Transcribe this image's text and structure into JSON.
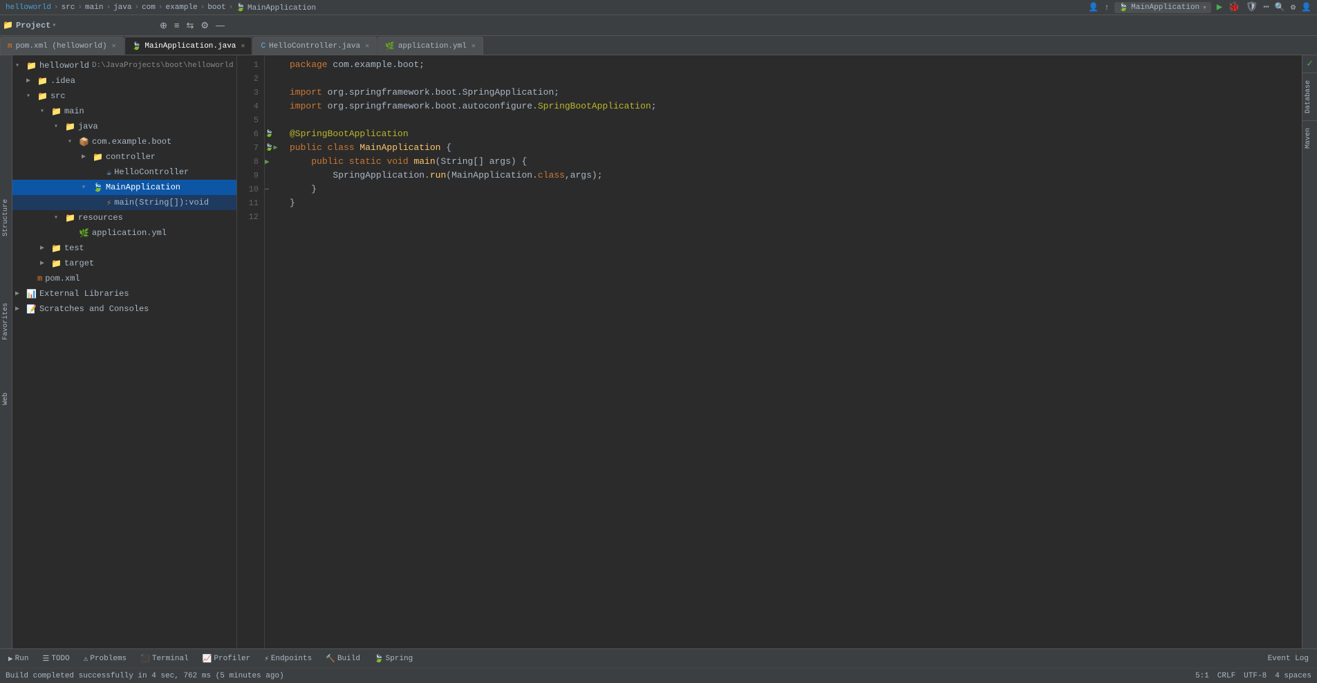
{
  "topbar": {
    "breadcrumb": [
      "helloworld",
      "src",
      "main",
      "java",
      "com",
      "example",
      "boot",
      "MainApplication"
    ],
    "app_name": "MainApplication",
    "run_icon": "▶",
    "search_icon": "🔍"
  },
  "toolbar": {
    "project_label": "Project",
    "icons": [
      "⊕",
      "≡",
      "⇆",
      "⚙",
      "—"
    ]
  },
  "tabs": [
    {
      "id": "pom",
      "label": "pom.xml (helloworld)",
      "type": "pom",
      "active": false
    },
    {
      "id": "main",
      "label": "MainApplication.java",
      "type": "java",
      "active": true
    },
    {
      "id": "hello",
      "label": "HelloController.java",
      "type": "java",
      "active": false
    },
    {
      "id": "app",
      "label": "application.yml",
      "type": "yml",
      "active": false
    }
  ],
  "sidebar": {
    "title": "Project",
    "tree": [
      {
        "id": "helloworld",
        "label": "helloworld",
        "path": "D:\\JavaProjects\\boot\\helloworld",
        "indent": 0,
        "type": "project",
        "expanded": true,
        "selected": false
      },
      {
        "id": "idea",
        "label": ".idea",
        "indent": 1,
        "type": "folder",
        "expanded": false,
        "selected": false
      },
      {
        "id": "src",
        "label": "src",
        "indent": 1,
        "type": "folder",
        "expanded": true,
        "selected": false
      },
      {
        "id": "main",
        "label": "main",
        "indent": 2,
        "type": "folder",
        "expanded": true,
        "selected": false
      },
      {
        "id": "java",
        "label": "java",
        "indent": 3,
        "type": "folder-java",
        "expanded": true,
        "selected": false
      },
      {
        "id": "com.example.boot",
        "label": "com.example.boot",
        "indent": 4,
        "type": "package",
        "expanded": true,
        "selected": false
      },
      {
        "id": "controller",
        "label": "controller",
        "indent": 5,
        "type": "folder",
        "expanded": true,
        "selected": false
      },
      {
        "id": "HelloController",
        "label": "HelloController",
        "indent": 6,
        "type": "java-class",
        "expanded": false,
        "selected": false
      },
      {
        "id": "MainApplication",
        "label": "MainApplication",
        "indent": 5,
        "type": "java-boot",
        "expanded": true,
        "selected": true
      },
      {
        "id": "main-method",
        "label": "main(String[]):void",
        "indent": 6,
        "type": "method",
        "expanded": false,
        "selected": false
      },
      {
        "id": "resources",
        "label": "resources",
        "indent": 3,
        "type": "folder-res",
        "expanded": true,
        "selected": false
      },
      {
        "id": "application.yml",
        "label": "application.yml",
        "indent": 4,
        "type": "yml",
        "expanded": false,
        "selected": false
      },
      {
        "id": "test",
        "label": "test",
        "indent": 2,
        "type": "folder",
        "expanded": false,
        "selected": false
      },
      {
        "id": "target",
        "label": "target",
        "indent": 2,
        "type": "folder",
        "expanded": false,
        "selected": false
      },
      {
        "id": "pom.xml",
        "label": "pom.xml",
        "indent": 1,
        "type": "pom",
        "expanded": false,
        "selected": false
      },
      {
        "id": "ext-libs",
        "label": "External Libraries",
        "indent": 0,
        "type": "ext-libs",
        "expanded": false,
        "selected": false
      },
      {
        "id": "scratches",
        "label": "Scratches and Consoles",
        "indent": 0,
        "type": "scratch",
        "expanded": false,
        "selected": false
      }
    ]
  },
  "editor": {
    "filename": "MainApplication.java",
    "lines": [
      {
        "num": 1,
        "tokens": [
          {
            "t": "pkg",
            "v": "package "
          },
          {
            "t": "cls",
            "v": "com.example.boot"
          },
          {
            "t": "cls",
            "v": ";"
          }
        ]
      },
      {
        "num": 2,
        "tokens": []
      },
      {
        "num": 3,
        "tokens": [
          {
            "t": "imp",
            "v": "import "
          },
          {
            "t": "cls",
            "v": "org.springframework.boot.SpringApplication"
          },
          {
            "t": "cls",
            "v": ";"
          }
        ]
      },
      {
        "num": 4,
        "tokens": [
          {
            "t": "imp",
            "v": "import "
          },
          {
            "t": "cls",
            "v": "org.springframework.boot.autoconfigure."
          },
          {
            "t": "ann",
            "v": "SpringBootApplication"
          },
          {
            "t": "cls",
            "v": ";"
          }
        ]
      },
      {
        "num": 5,
        "tokens": []
      },
      {
        "num": 6,
        "tokens": [
          {
            "t": "ann",
            "v": "@SpringBootApplication"
          }
        ],
        "gutter": true
      },
      {
        "num": 7,
        "tokens": [
          {
            "t": "kw",
            "v": "public "
          },
          {
            "t": "kw",
            "v": "class "
          },
          {
            "t": "cls2",
            "v": "MainApplication "
          },
          {
            "t": "cls",
            "v": "{"
          }
        ],
        "gutter": true
      },
      {
        "num": 8,
        "tokens": [
          {
            "t": "",
            "v": "    "
          },
          {
            "t": "kw",
            "v": "public "
          },
          {
            "t": "kw",
            "v": "static "
          },
          {
            "t": "kw",
            "v": "void "
          },
          {
            "t": "fn",
            "v": "main"
          },
          {
            "t": "cls",
            "v": "("
          },
          {
            "t": "cls",
            "v": "String"
          },
          {
            "t": "cls",
            "v": "[] "
          },
          {
            "t": "cls",
            "v": "args) {"
          }
        ],
        "gutter": true
      },
      {
        "num": 9,
        "tokens": [
          {
            "t": "",
            "v": "        "
          },
          {
            "t": "cls",
            "v": "SpringApplication."
          },
          {
            "t": "fn",
            "v": "run"
          },
          {
            "t": "cls",
            "v": "("
          },
          {
            "t": "cls",
            "v": "MainApplication"
          },
          {
            "t": "cls",
            "v": "."
          },
          {
            "t": "kw",
            "v": "class"
          },
          {
            "t": "cls",
            "v": ",args);"
          }
        ]
      },
      {
        "num": 10,
        "tokens": [
          {
            "t": "",
            "v": "    "
          },
          {
            "t": "cls",
            "v": "}"
          }
        ],
        "gutter": true
      },
      {
        "num": 11,
        "tokens": [
          {
            "t": "cls",
            "v": "}"
          }
        ]
      },
      {
        "num": 12,
        "tokens": []
      }
    ]
  },
  "bottom_toolbar": {
    "run": "Run",
    "todo": "TODO",
    "problems": "Problems",
    "terminal": "Terminal",
    "profiler": "Profiler",
    "endpoints": "Endpoints",
    "build": "Build",
    "spring": "Spring",
    "event_log": "Event Log"
  },
  "status_bar": {
    "message": "Build completed successfully in 4 sec, 762 ms (5 minutes ago)",
    "position": "5:1",
    "encoding": "CRLF",
    "charset": "UTF-8",
    "indent": "4 spaces"
  },
  "right_panel": {
    "database": "Database",
    "maven": "Maven"
  },
  "left_panel": {
    "structure": "Structure",
    "favorites": "Favorites",
    "web": "Web"
  }
}
